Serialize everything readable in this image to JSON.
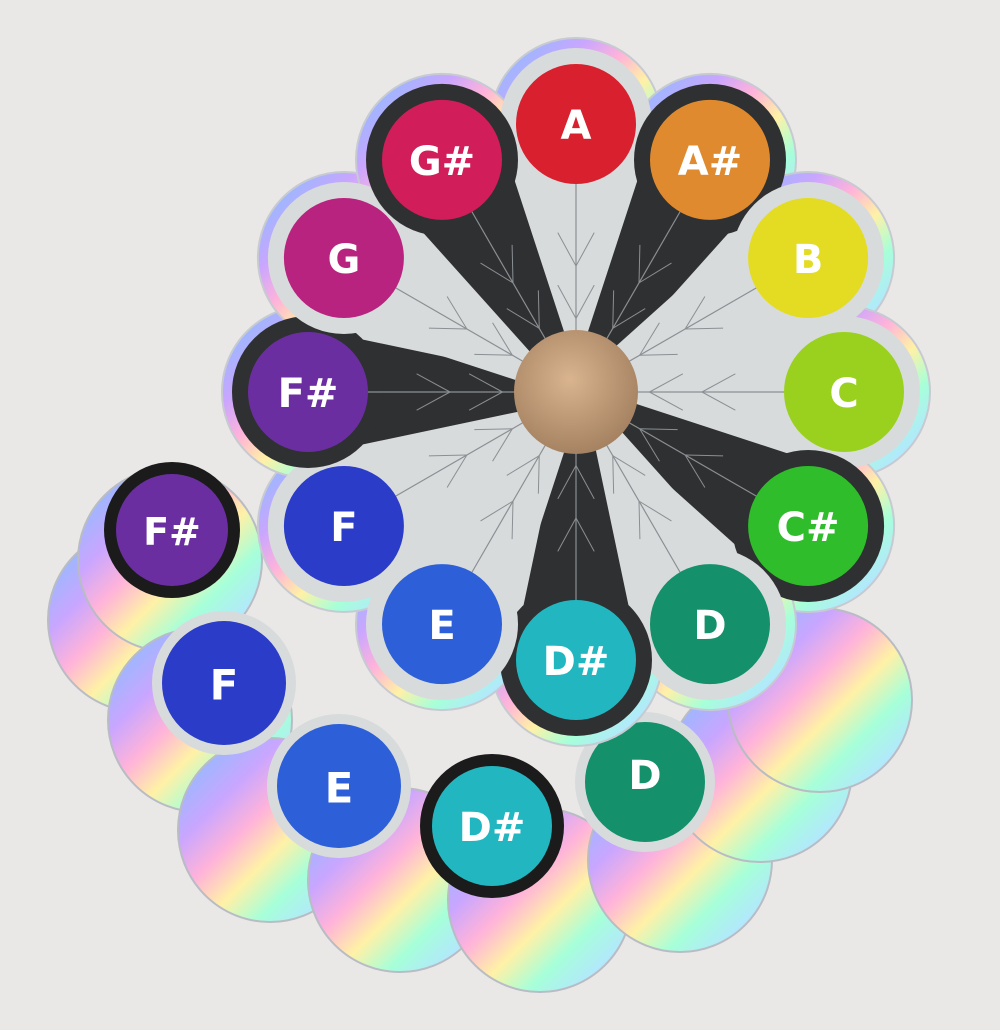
{
  "photo": {
    "background_color": "#e9e8e6",
    "holo_colors": [
      "#d9dde2",
      "#9fb6ff",
      "#c9a6ff",
      "#ffb3d9",
      "#fff1a6",
      "#a6ffd9",
      "#b3e6ff",
      "#f2f2f2"
    ]
  },
  "front_sticker": {
    "notes": [
      {
        "label": "A",
        "color": "#d8202f",
        "bg": "light"
      },
      {
        "label": "A#",
        "color": "#df8a2e",
        "bg": "dark"
      },
      {
        "label": "B",
        "color": "#e3dc22",
        "bg": "light"
      },
      {
        "label": "C",
        "color": "#9ad11f",
        "bg": "light"
      },
      {
        "label": "C#",
        "color": "#2fbd2b",
        "bg": "dark"
      },
      {
        "label": "D",
        "color": "#14906a",
        "bg": "light"
      },
      {
        "label": "D#",
        "color": "#22b7c0",
        "bg": "dark"
      },
      {
        "label": "E",
        "color": "#2c5fd8",
        "bg": "light"
      },
      {
        "label": "F",
        "color": "#2a3cc8",
        "bg": "light"
      },
      {
        "label": "F#",
        "color": "#6b2ea0",
        "bg": "dark"
      },
      {
        "label": "G",
        "color": "#b8237f",
        "bg": "light"
      },
      {
        "label": "G#",
        "color": "#d11d5a",
        "bg": "dark"
      }
    ],
    "center_color": "#c59a72",
    "petal_light_color": "#d8dbdc",
    "petal_dark_color": "#2f3031"
  },
  "back_stickers": {
    "visible_notes": [
      {
        "label": "F#",
        "color": "#6b2ea0",
        "bg": "dark"
      },
      {
        "label": "F",
        "color": "#2a3cc8",
        "bg": "light"
      },
      {
        "label": "E",
        "color": "#2c5fd8",
        "bg": "light"
      },
      {
        "label": "D#",
        "color": "#22b7c0",
        "bg": "dark"
      },
      {
        "label": "D",
        "color": "#14906a",
        "bg": "light"
      }
    ]
  }
}
